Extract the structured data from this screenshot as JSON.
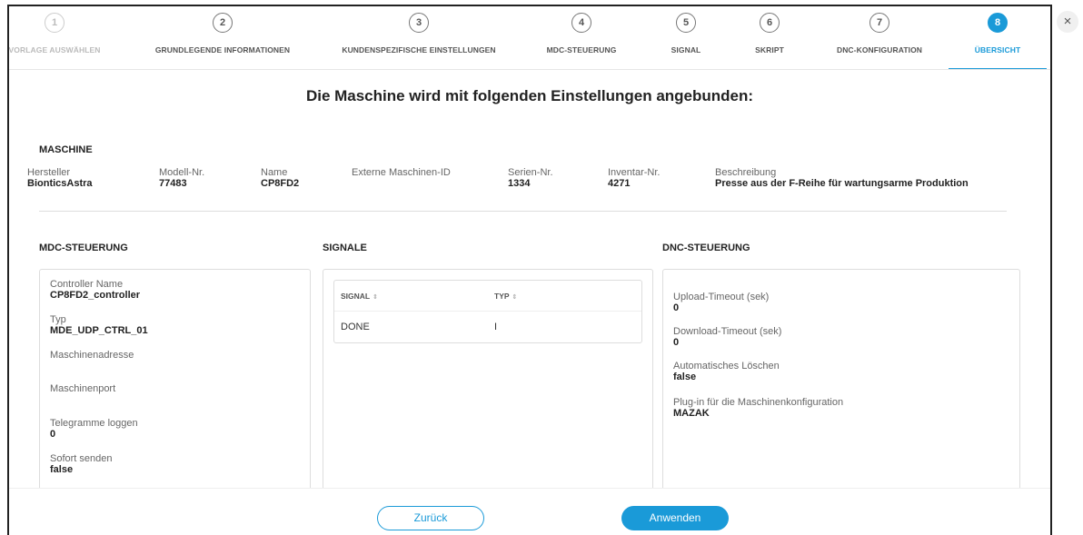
{
  "wizard": {
    "steps": [
      {
        "num": "1",
        "label": "VORLAGE AUSWÄHLEN"
      },
      {
        "num": "2",
        "label": "GRUNDLEGENDE INFORMATIONEN"
      },
      {
        "num": "3",
        "label": "KUNDENSPEZIFISCHE EINSTELLUNGEN"
      },
      {
        "num": "4",
        "label": "MDC-STEUERUNG"
      },
      {
        "num": "5",
        "label": "SIGNAL"
      },
      {
        "num": "6",
        "label": "SKRIPT"
      },
      {
        "num": "7",
        "label": "DNC-KONFIGURATION"
      },
      {
        "num": "8",
        "label": "ÜBERSICHT"
      }
    ],
    "close_label": "×"
  },
  "main": {
    "heading": "Die Maschine wird mit folgenden Einstellungen angebunden:"
  },
  "machine": {
    "title": "MASCHINE",
    "fields": [
      {
        "label": "Hersteller",
        "value": "BionticsAstra"
      },
      {
        "label": "Modell-Nr.",
        "value": "77483"
      },
      {
        "label": "Name",
        "value": "CP8FD2"
      },
      {
        "label": "Externe Maschinen-ID",
        "value": ""
      },
      {
        "label": "Serien-Nr.",
        "value": "1334"
      },
      {
        "label": "Inventar-Nr.",
        "value": "4271"
      },
      {
        "label": "Beschreibung",
        "value": "Presse aus der F-Reihe für wartungsarme Produktion"
      }
    ]
  },
  "mdc": {
    "title": "MDC-STEUERUNG",
    "fields": [
      {
        "label": "Controller Name",
        "value": "CP8FD2_controller"
      },
      {
        "label": "Typ",
        "value": "MDE_UDP_CTRL_01"
      },
      {
        "label": "Maschinenadresse",
        "value": ""
      },
      {
        "label": "Maschinenport",
        "value": ""
      },
      {
        "label": "Telegramme loggen",
        "value": "0"
      },
      {
        "label": "Sofort senden",
        "value": "false"
      }
    ]
  },
  "signals": {
    "title": "SIGNALE",
    "columns": [
      "SIGNAL",
      "TYP"
    ],
    "rows": [
      [
        "DONE",
        "I"
      ]
    ],
    "sort_glyph": "⇕"
  },
  "dnc": {
    "title": "DNC-STEUERUNG",
    "fields": [
      {
        "label": "Upload-Timeout (sek)",
        "value": "0"
      },
      {
        "label": "Download-Timeout (sek)",
        "value": "0"
      },
      {
        "label": "Automatisches Löschen",
        "value": "false"
      },
      {
        "label": "Plug-in für die Maschinenkonfiguration",
        "value": "MAZAK"
      }
    ]
  },
  "footer": {
    "back_label": "Zurück",
    "apply_label": "Anwenden"
  },
  "colors": {
    "accent": "#1a9ad8"
  }
}
